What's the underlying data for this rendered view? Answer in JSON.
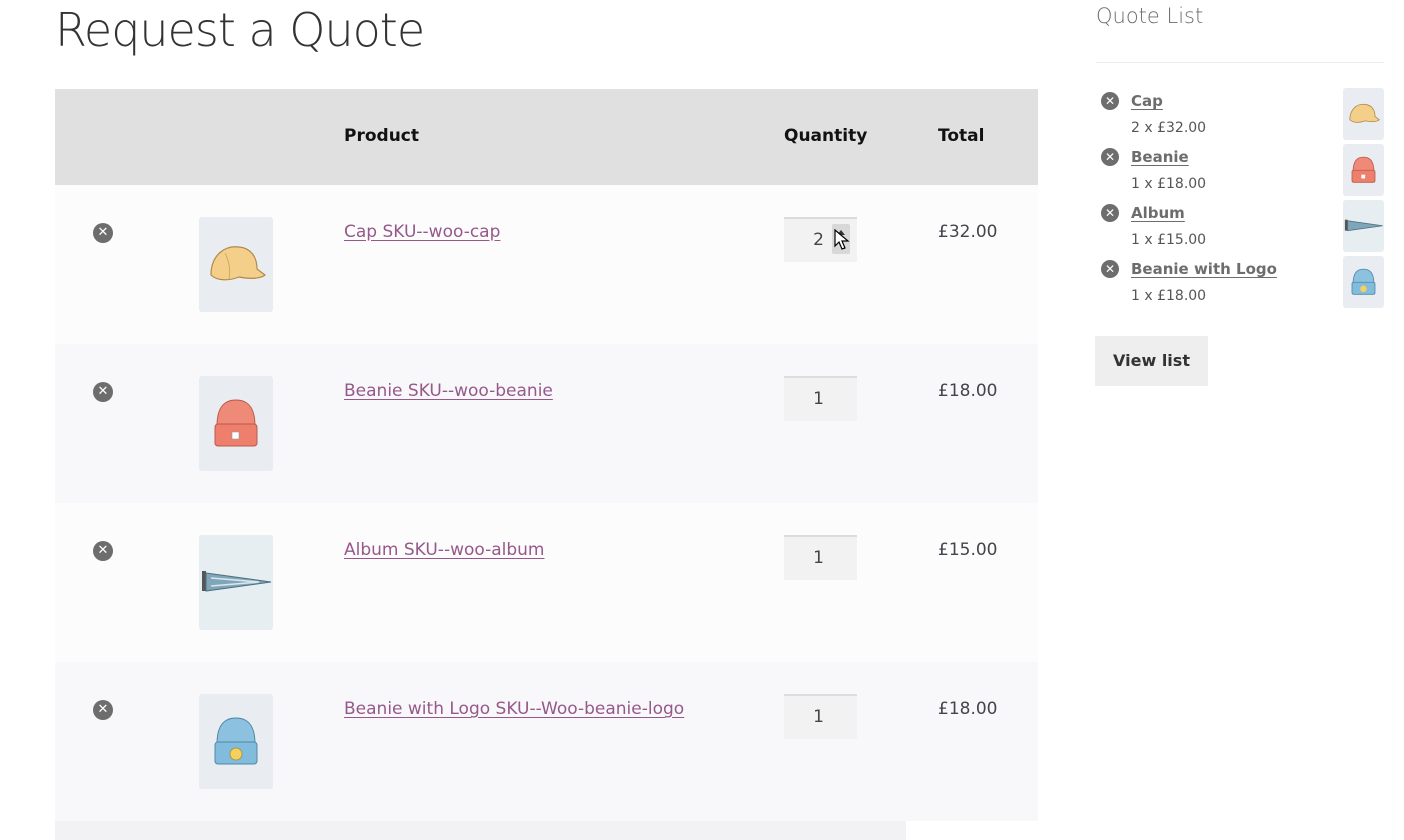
{
  "page": {
    "title": "Request a Quote"
  },
  "table": {
    "headers": {
      "product": "Product",
      "quantity": "Quantity",
      "total": "Total"
    },
    "rows": [
      {
        "product": "Cap SKU--woo-cap",
        "quantity": "2",
        "total": "£32.00",
        "icon": "cap-icon"
      },
      {
        "product": "Beanie SKU--woo-beanie",
        "quantity": "1",
        "total": "£18.00",
        "icon": "beanie-icon"
      },
      {
        "product": "Album SKU--woo-album",
        "quantity": "1",
        "total": "£15.00",
        "icon": "pennant-icon"
      },
      {
        "product": "Beanie with Logo SKU--Woo-beanie-logo",
        "quantity": "1",
        "total": "£18.00",
        "icon": "beanie-logo-icon"
      }
    ],
    "remove_symbol": "✕"
  },
  "widget": {
    "title": "Quote List",
    "items": [
      {
        "name": "Cap",
        "qty": "2 x £32.00"
      },
      {
        "name": "Beanie",
        "qty": "1 x £18.00"
      },
      {
        "name": "Album",
        "qty": "1 x £15.00"
      },
      {
        "name": "Beanie with Logo",
        "qty": "1 x £18.00"
      }
    ],
    "view_button": "View list"
  },
  "colors": {
    "link": "#96588a",
    "header_bg": "#e0e0e0",
    "remove_bg": "#6d6d6d"
  }
}
